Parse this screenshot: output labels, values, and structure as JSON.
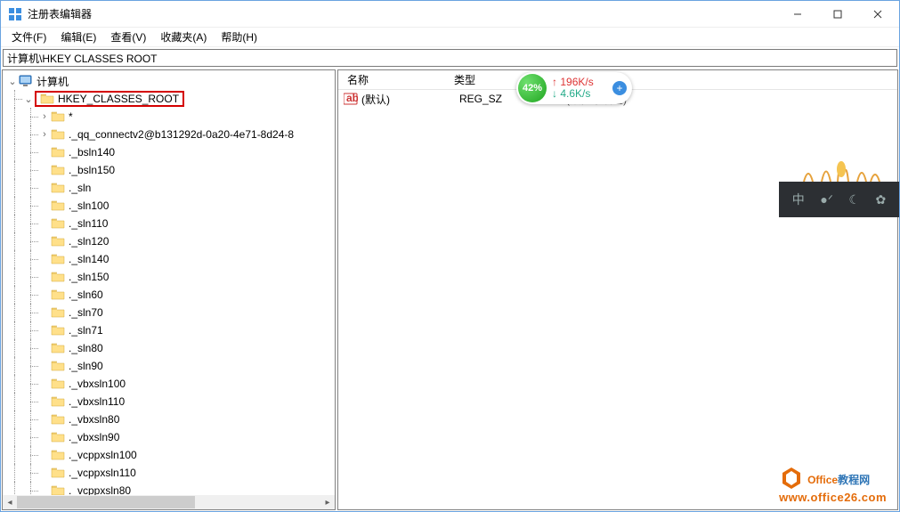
{
  "window": {
    "title": "注册表编辑器",
    "menus": [
      "文件(F)",
      "编辑(E)",
      "查看(V)",
      "收藏夹(A)",
      "帮助(H)"
    ],
    "address": "计算机\\HKEY CLASSES ROOT"
  },
  "tree": {
    "root": "计算机",
    "selected": "HKEY_CLASSES_ROOT",
    "children": [
      "*",
      "._qq_connectv2@b131292d-0a20-4e71-8d24-8",
      "._bsln140",
      "._bsln150",
      "._sln",
      "._sln100",
      "._sln110",
      "._sln120",
      "._sln140",
      "._sln150",
      "._sln60",
      "._sln70",
      "._sln71",
      "._sln80",
      "._sln90",
      "._vbxsln100",
      "._vbxsln110",
      "._vbxsln80",
      "._vbxsln90",
      "._vcppxsln100",
      "._vcppxsln110",
      "._vcppxsln80"
    ]
  },
  "list": {
    "columns": {
      "name": "名称",
      "type": "类型"
    },
    "rows": [
      {
        "name": "(默认)",
        "type": "REG_SZ",
        "data": "(数值未设置)"
      }
    ]
  },
  "netwidget": {
    "percent": "42%",
    "up": "196K/s",
    "down": "4.6K/s"
  },
  "darkwidget": {
    "icons": [
      "中",
      "●ᐟ",
      "☾",
      "✿"
    ]
  },
  "watermark": {
    "brand1": "Office",
    "brand2": "教程网",
    "url": "www.office26.com"
  }
}
